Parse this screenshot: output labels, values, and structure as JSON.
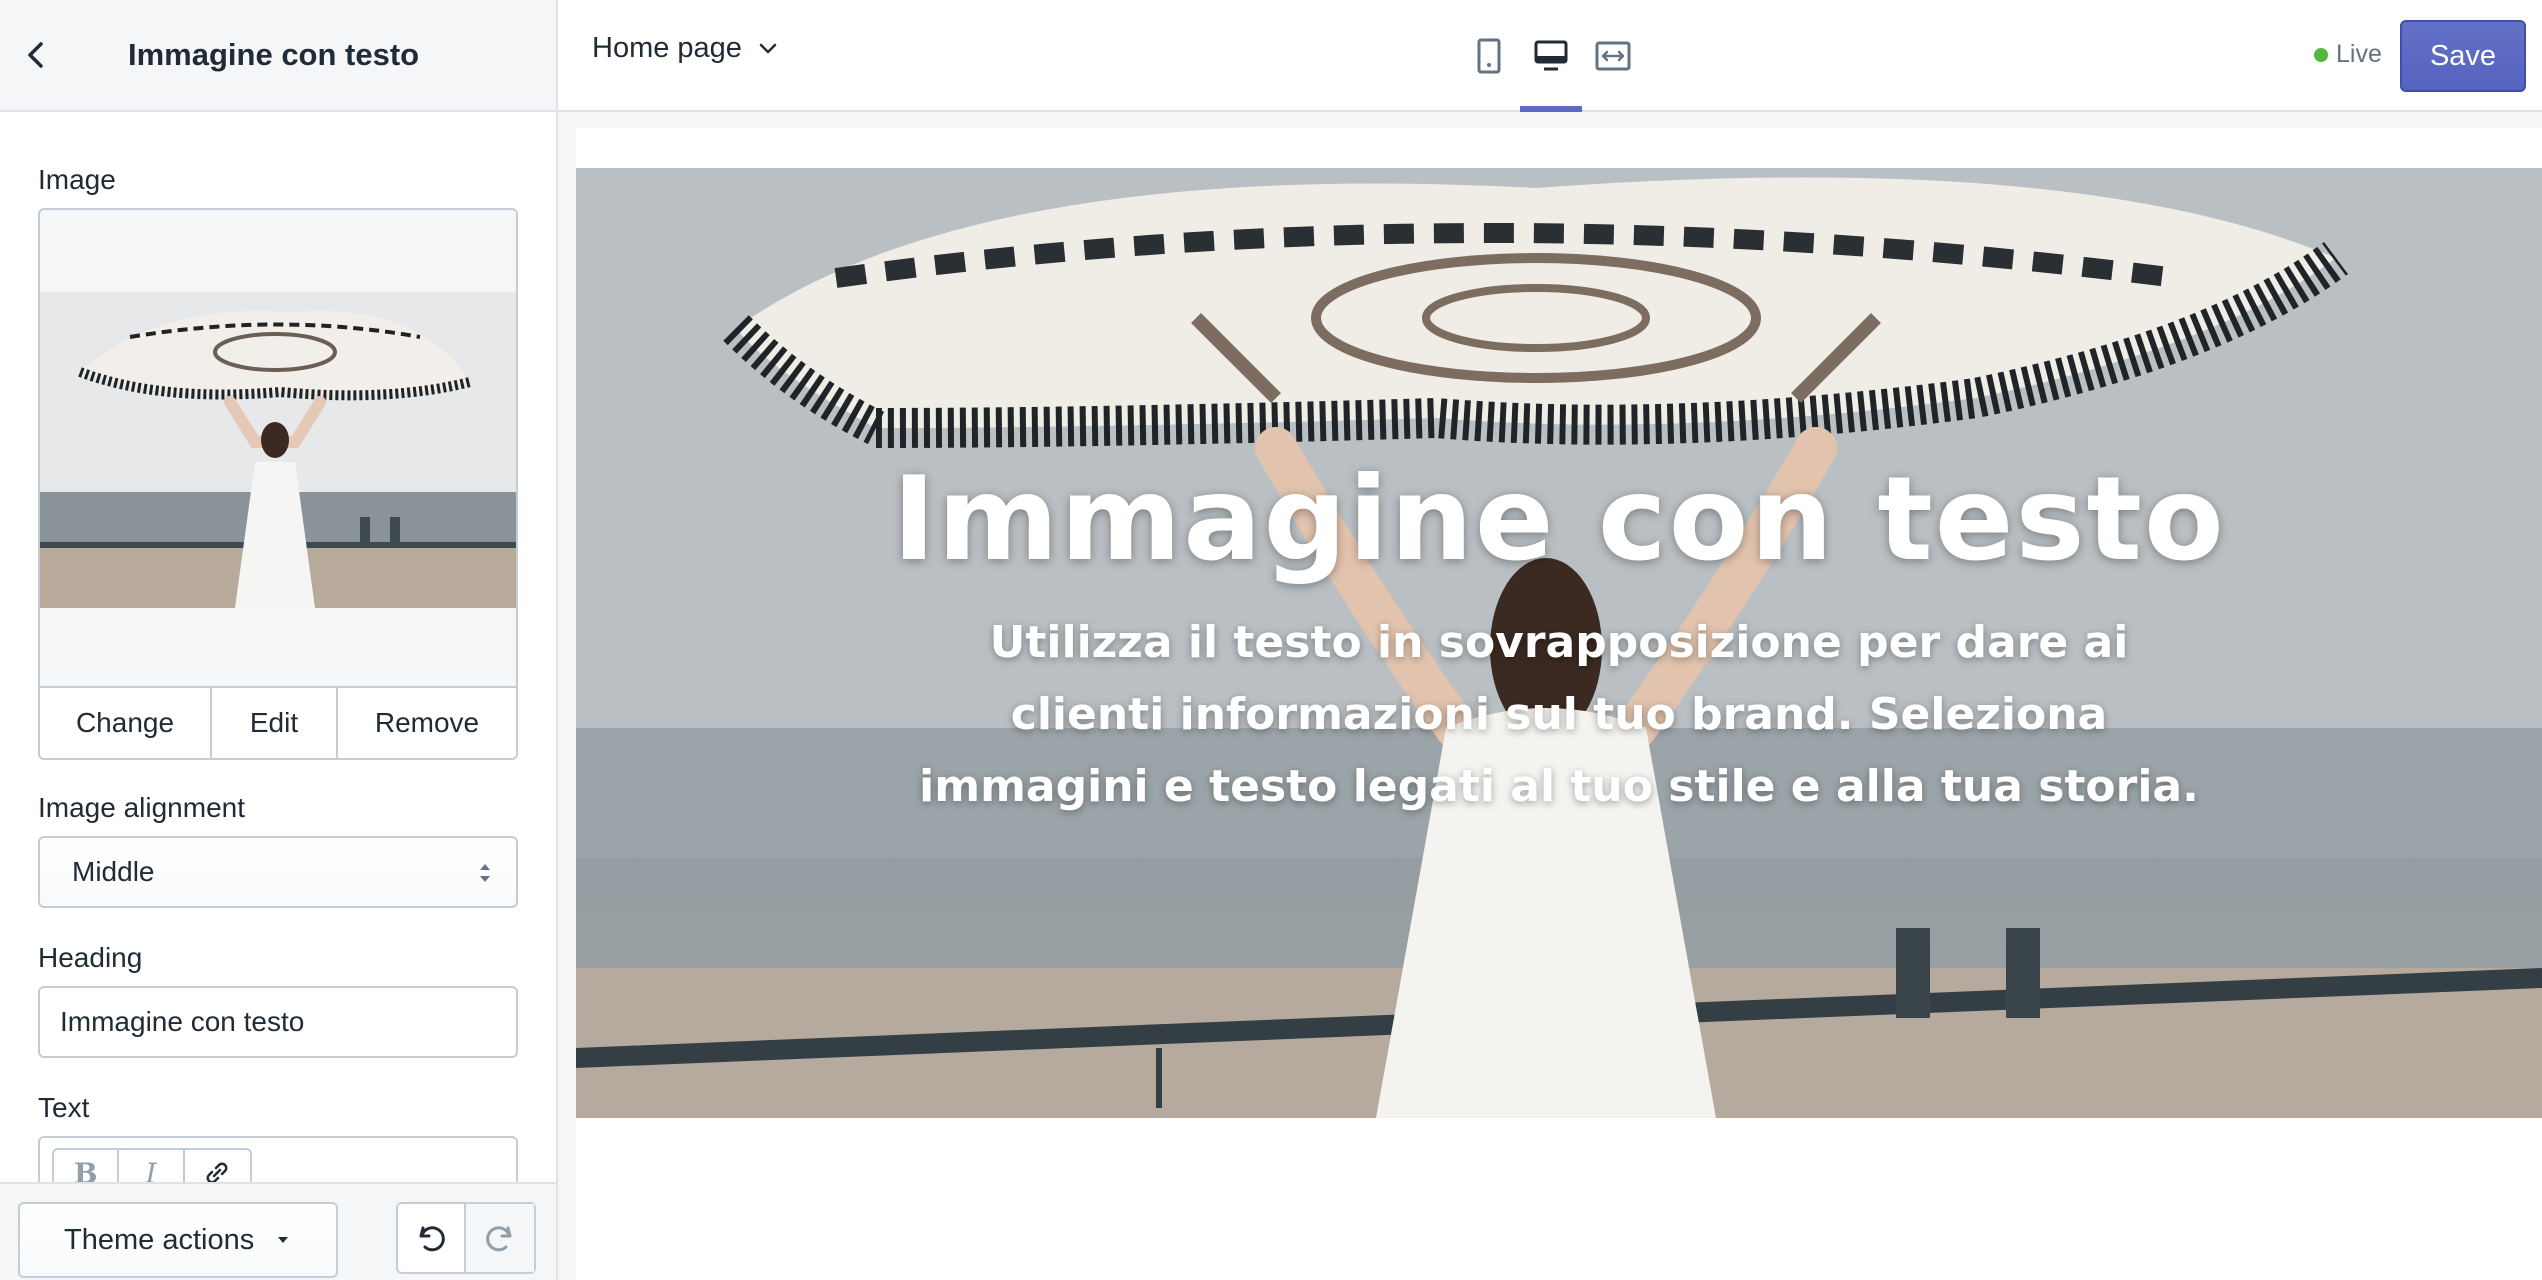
{
  "sidebar": {
    "title": "Immagine con testo",
    "image_label": "Image",
    "image_actions": [
      "Change",
      "Edit",
      "Remove"
    ],
    "alignment_label": "Image alignment",
    "alignment_value": "Middle",
    "heading_label": "Heading",
    "heading_value": "Immagine con testo",
    "text_label": "Text",
    "rte_tools": [
      "B",
      "I",
      "link"
    ]
  },
  "footer": {
    "theme_actions_label": "Theme actions"
  },
  "topbar": {
    "page_label": "Home page",
    "devices": [
      "mobile",
      "desktop",
      "full-width"
    ],
    "active_device": "desktop",
    "status": "Live",
    "save_label": "Save"
  },
  "preview": {
    "hero_title": "Immagine con testo",
    "hero_text": "Utilizza il testo in sovrapposizione per dare ai clienti informazioni sul tuo brand. Seleziona immagini e testo legati al tuo stile e alla tua storia."
  },
  "colors": {
    "accent": "#5c6ac4",
    "live_dot": "#50b83c",
    "border": "#c4cdd5"
  }
}
